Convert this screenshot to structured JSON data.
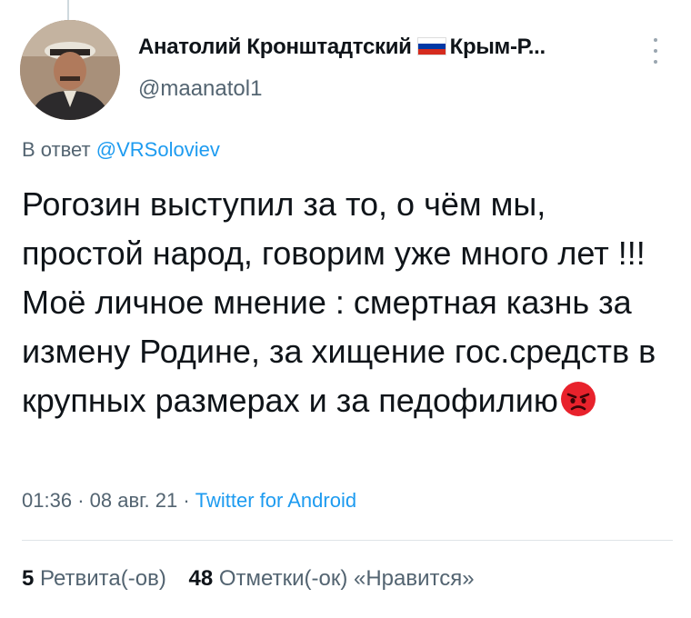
{
  "author": {
    "name_part1": "Анатолий Кронштадтский",
    "name_part2": "Крым-Р...",
    "handle": "@maanatol1"
  },
  "reply": {
    "prefix": "В ответ",
    "to": "@VRSoloviev"
  },
  "tweet": {
    "text": "Рогозин выступил за то, о чём мы, простой народ, говорим уже много лет !!! Моё личное мнение : смертная казнь за измену Родине, за хищение гос.средств в крупных размерах и за педофилию",
    "emoji": "angry-face",
    "time": "01:36",
    "date": "08 авг. 21",
    "separator": "·",
    "source": "Twitter for Android"
  },
  "stats": {
    "retweets_count": "5",
    "retweets_label": "Ретвита(-ов)",
    "likes_count": "48",
    "likes_label": "Отметки(-ок) «Нравится»"
  },
  "colors": {
    "accent": "#1d9bf0",
    "secondary_text": "#536471",
    "primary_text": "#0f1419",
    "flag_white": "#ffffff",
    "flag_blue": "#0039a6",
    "flag_red": "#d52b1e"
  },
  "icons": {
    "flag": "russian-flag-icon",
    "more": "more-vertical-icon"
  }
}
